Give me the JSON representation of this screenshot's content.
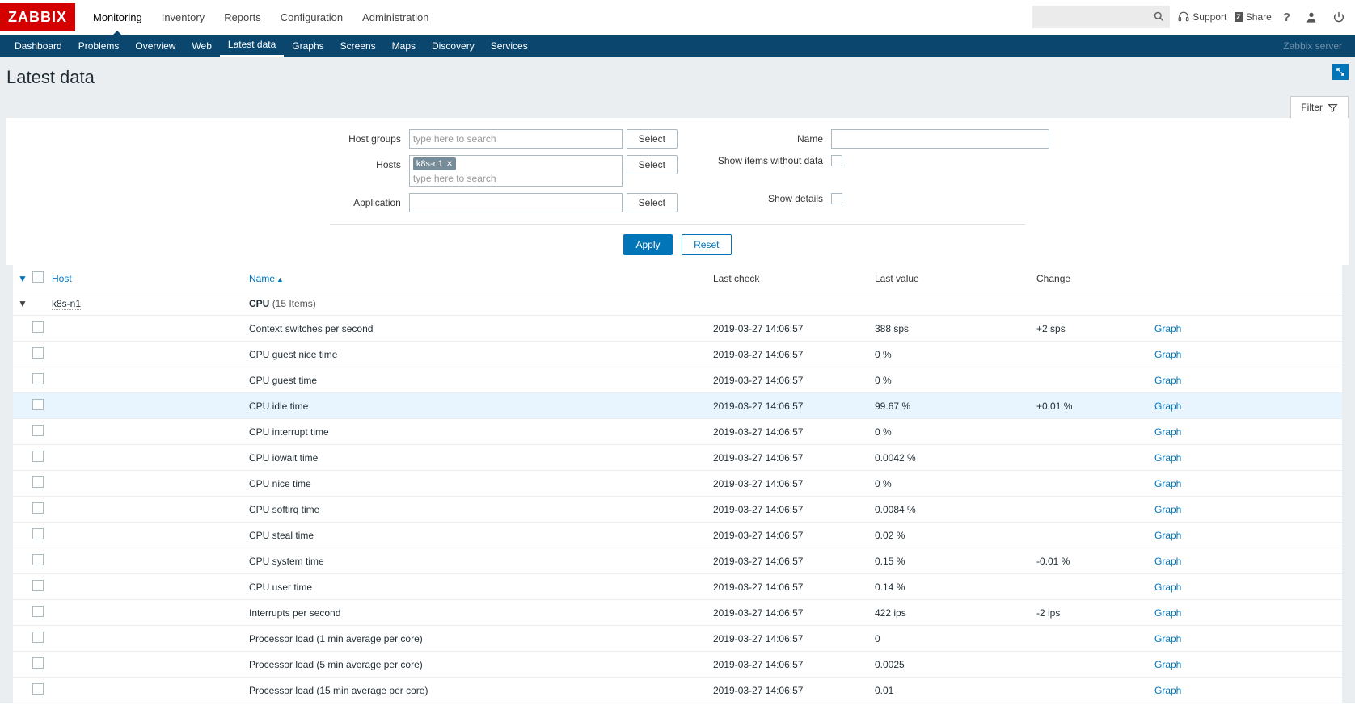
{
  "brand": "ZABBIX",
  "topnav": [
    "Monitoring",
    "Inventory",
    "Reports",
    "Configuration",
    "Administration"
  ],
  "topnav_active": 0,
  "top_right": {
    "support": "Support",
    "share": "Share"
  },
  "subnav": [
    "Dashboard",
    "Problems",
    "Overview",
    "Web",
    "Latest data",
    "Graphs",
    "Screens",
    "Maps",
    "Discovery",
    "Services"
  ],
  "subnav_active": 4,
  "server_label": "Zabbix server",
  "page_title": "Latest data",
  "filter_tab": "Filter",
  "filter": {
    "host_groups_label": "Host groups",
    "host_groups_placeholder": "type here to search",
    "hosts_label": "Hosts",
    "hosts_tag": "k8s-n1",
    "hosts_placeholder": "type here to search",
    "application_label": "Application",
    "name_label": "Name",
    "show_without_data_label": "Show items without data",
    "show_details_label": "Show details",
    "select_label": "Select",
    "apply_label": "Apply",
    "reset_label": "Reset"
  },
  "columns": {
    "host": "Host",
    "name": "Name",
    "last_check": "Last check",
    "last_value": "Last value",
    "change": "Change"
  },
  "group": {
    "host": "k8s-n1",
    "app": "CPU",
    "count": "(15 Items)"
  },
  "graph_label": "Graph",
  "rows": [
    {
      "name": "Context switches per second",
      "check": "2019-03-27 14:06:57",
      "value": "388 sps",
      "change": "+2 sps",
      "hl": false
    },
    {
      "name": "CPU guest nice time",
      "check": "2019-03-27 14:06:57",
      "value": "0 %",
      "change": "",
      "hl": false
    },
    {
      "name": "CPU guest time",
      "check": "2019-03-27 14:06:57",
      "value": "0 %",
      "change": "",
      "hl": false
    },
    {
      "name": "CPU idle time",
      "check": "2019-03-27 14:06:57",
      "value": "99.67 %",
      "change": "+0.01 %",
      "hl": true
    },
    {
      "name": "CPU interrupt time",
      "check": "2019-03-27 14:06:57",
      "value": "0 %",
      "change": "",
      "hl": false
    },
    {
      "name": "CPU iowait time",
      "check": "2019-03-27 14:06:57",
      "value": "0.0042 %",
      "change": "",
      "hl": false
    },
    {
      "name": "CPU nice time",
      "check": "2019-03-27 14:06:57",
      "value": "0 %",
      "change": "",
      "hl": false
    },
    {
      "name": "CPU softirq time",
      "check": "2019-03-27 14:06:57",
      "value": "0.0084 %",
      "change": "",
      "hl": false
    },
    {
      "name": "CPU steal time",
      "check": "2019-03-27 14:06:57",
      "value": "0.02 %",
      "change": "",
      "hl": false
    },
    {
      "name": "CPU system time",
      "check": "2019-03-27 14:06:57",
      "value": "0.15 %",
      "change": "-0.01 %",
      "hl": false
    },
    {
      "name": "CPU user time",
      "check": "2019-03-27 14:06:57",
      "value": "0.14 %",
      "change": "",
      "hl": false
    },
    {
      "name": "Interrupts per second",
      "check": "2019-03-27 14:06:57",
      "value": "422 ips",
      "change": "-2 ips",
      "hl": false
    },
    {
      "name": "Processor load (1 min average per core)",
      "check": "2019-03-27 14:06:57",
      "value": "0",
      "change": "",
      "hl": false
    },
    {
      "name": "Processor load (5 min average per core)",
      "check": "2019-03-27 14:06:57",
      "value": "0.0025",
      "change": "",
      "hl": false
    },
    {
      "name": "Processor load (15 min average per core)",
      "check": "2019-03-27 14:06:57",
      "value": "0.01",
      "change": "",
      "hl": false
    }
  ]
}
